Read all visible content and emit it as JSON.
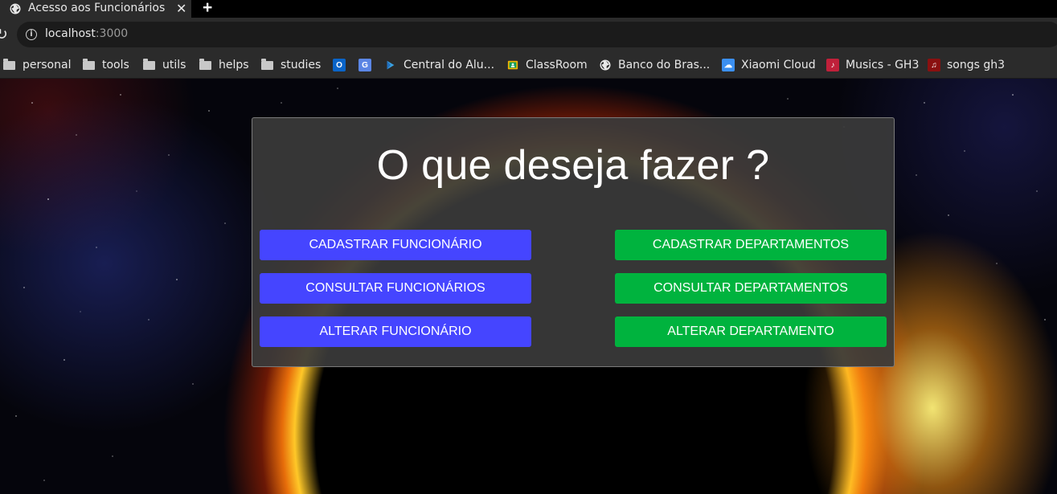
{
  "browser": {
    "tab_title": "Acesso aos Funcionários",
    "close_glyph": "✕",
    "new_tab_glyph": "+",
    "url_host": "localhost",
    "url_port": ":3000",
    "bookmarks": [
      {
        "label": "personal",
        "icon": "folder-icon"
      },
      {
        "label": "tools",
        "icon": "folder-icon"
      },
      {
        "label": "utils",
        "icon": "folder-icon"
      },
      {
        "label": "helps",
        "icon": "folder-icon"
      },
      {
        "label": "studies",
        "icon": "folder-icon"
      },
      {
        "label": "",
        "icon": "outlook-icon"
      },
      {
        "label": "",
        "icon": "translate-icon"
      },
      {
        "label": "Central do Alu...",
        "icon": "play-icon"
      },
      {
        "label": "ClassRoom",
        "icon": "classroom-icon"
      },
      {
        "label": "Banco do Bras...",
        "icon": "globe-icon"
      },
      {
        "label": "Xiaomi Cloud",
        "icon": "cloud-icon"
      },
      {
        "label": "Musics - GH3",
        "icon": "gh3-icon"
      },
      {
        "label": "songs gh3",
        "icon": "songs-icon"
      }
    ]
  },
  "page": {
    "heading": "O que deseja fazer ?",
    "buttons": {
      "cadastrar_funcionario": "CADASTRAR FUNCIONÁRIO",
      "consultar_funcionarios": "CONSULTAR FUNCIONÁRIOS",
      "alterar_funcionario": "ALTERAR FUNCIONÁRIO",
      "cadastrar_departamentos": "CADASTRAR DEPARTAMENTOS",
      "consultar_departamentos": "CONSULTAR DEPARTAMENTOS",
      "alterar_departamento": "ALTERAR DEPARTAMENTO"
    }
  },
  "colors": {
    "employee_buttons": "#4545ff",
    "department_buttons": "#00b33e",
    "panel": "#3a3a3a"
  }
}
